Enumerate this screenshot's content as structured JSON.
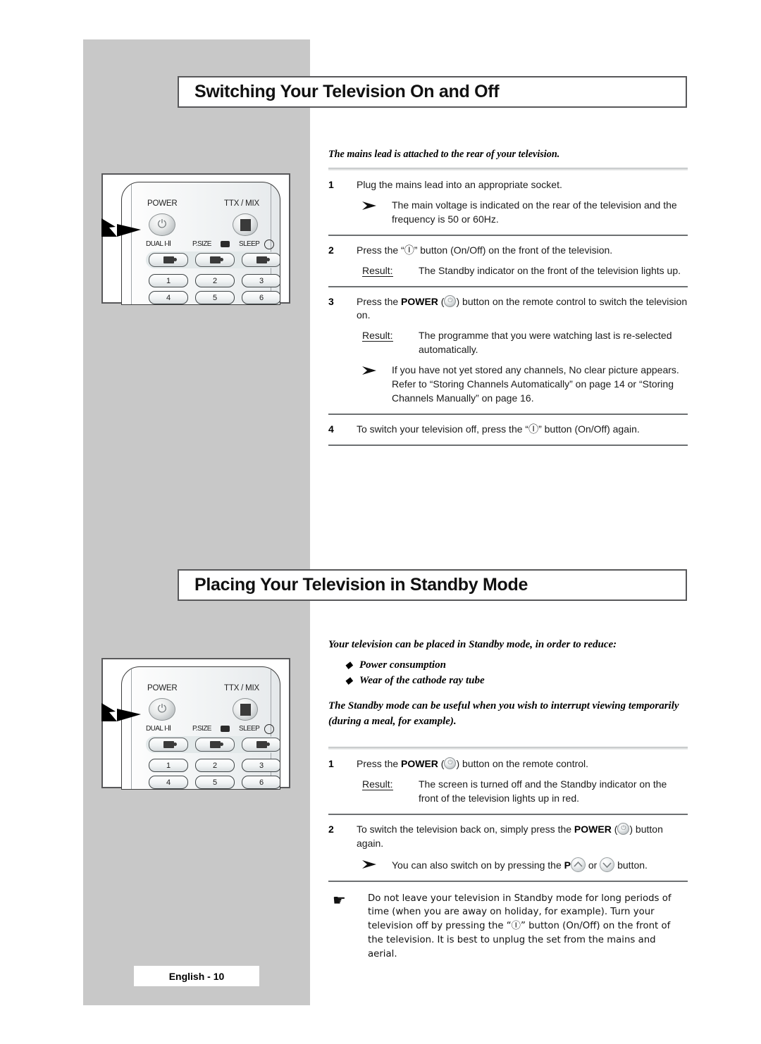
{
  "page": {
    "footer_label": "English - 10",
    "accent_grey": "#c8c8c8",
    "border_grey": "#58585a"
  },
  "section1": {
    "heading": "Switching Your Television On and Off",
    "intro": "The mains lead is attached to the rear of your television.",
    "steps": [
      {
        "num": "1",
        "text": "Plug the mains lead into an appropriate socket.",
        "sub": "The main voltage is indicated on the rear of the television and the frequency is 50 or 60Hz."
      },
      {
        "num": "2",
        "text_a": "Press the “",
        "text_b": "” button (On/Off) on the front of the television.",
        "result_label": "Result:",
        "result": "The Standby indicator on the front of the television lights up."
      },
      {
        "num": "3",
        "text_a": "Press the ",
        "power_word": "POWER",
        "text_b": " (",
        "text_c": ") button on the remote control to switch the television on.",
        "result_label": "Result:",
        "result": "The programme that you were watching last is re-selected automatically.",
        "sub": "If you have not yet stored any channels, No clear picture appears. Refer to “Storing Channels Automatically” on page 14 or “Storing Channels Manually” on page 16."
      },
      {
        "num": "4",
        "text_a": "To switch your television off, press the “",
        "text_b": "” button (On/Off) again."
      }
    ]
  },
  "section2": {
    "heading": "Placing Your Television in Standby Mode",
    "intro": "Your television can be placed in Standby mode, in order to reduce:",
    "bullets": [
      "Power consumption",
      "Wear of the cathode ray tube"
    ],
    "intro2": "The Standby mode can be useful when you wish to interrupt viewing temporarily (during a meal, for example).",
    "steps": [
      {
        "num": "1",
        "text_a": "Press the ",
        "power_word": "POWER",
        "text_b": " (",
        "text_c": ") button on the remote control.",
        "result_label": "Result:",
        "result": "The screen is turned off and the Standby indicator on the front of the television lights up in red."
      },
      {
        "num": "2",
        "text_a": "To switch the television back on, simply press the ",
        "power_word": "POWER",
        "text_b": " (",
        "text_c": ") button again.",
        "sub_a": "You can also switch on by pressing the ",
        "sub_p": "P",
        "sub_b": " or ",
        "sub_c": " button."
      }
    ],
    "note": "Do not leave your television in Standby mode for long periods of time (when you are away on holiday, for example). Turn your television off by pressing the “Ⓘ” button (On/Off) on the front of the television. It is best to unplug the set from the mains and aerial.",
    "note_marker": "☛"
  },
  "remote": {
    "power_label": "POWER",
    "ttx_label": "TTX / MIX",
    "fn_labels": [
      "DUAL I-Ⅱ",
      "P.SIZE",
      "SLEEP"
    ],
    "numbers": [
      "1",
      "2",
      "3",
      "4",
      "5",
      "6"
    ]
  },
  "glyphs": {
    "onoff": "Ⓘ",
    "arrow_bullet": "➢",
    "diamond": "◆"
  }
}
